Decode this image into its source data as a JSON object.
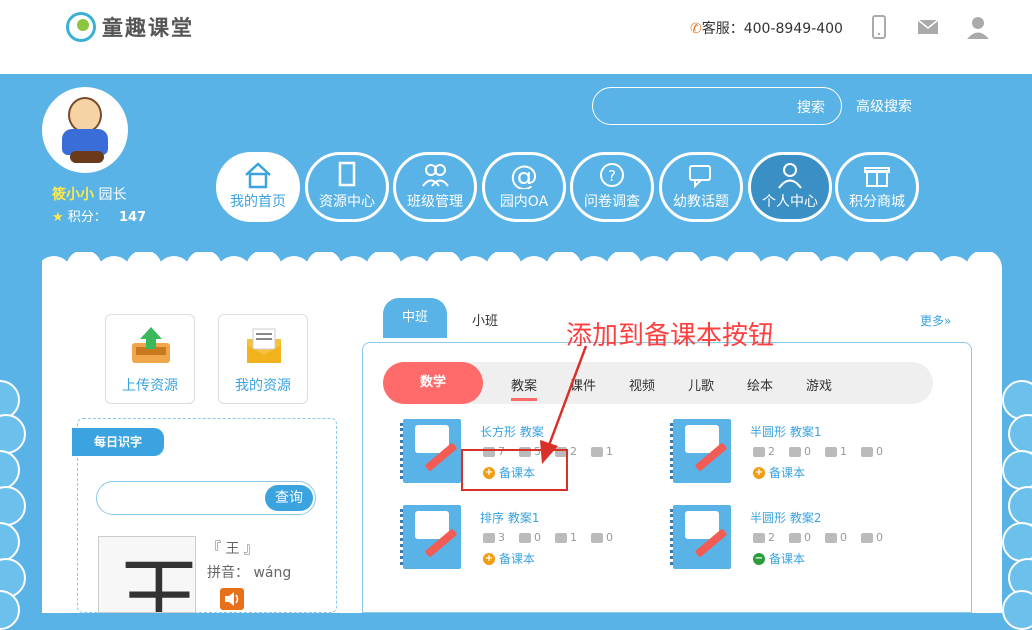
{
  "header": {
    "logo_text": "童趣课堂",
    "service_label": "客服：",
    "service_phone": "400-8949-400"
  },
  "user": {
    "name": "筱小小",
    "role": "园长",
    "points_label": "积分：",
    "points": "147"
  },
  "search": {
    "button": "搜索",
    "advanced": "高级搜索"
  },
  "nav": [
    {
      "label": "我的首页"
    },
    {
      "label": "资源中心"
    },
    {
      "label": "班级管理"
    },
    {
      "label": "园内OA"
    },
    {
      "label": "问卷调查"
    },
    {
      "label": "幼教话题"
    },
    {
      "label": "个人中心"
    },
    {
      "label": "积分商城"
    }
  ],
  "quick": {
    "upload": "上传资源",
    "mine": "我的资源"
  },
  "daily_word": {
    "tag": "每日识字",
    "query_btn": "查询",
    "char": "王",
    "char_name": "『 王 』",
    "pinyin_label": "拼音：",
    "pinyin": "wáng"
  },
  "class_tabs": {
    "active": "中班",
    "other": "小班",
    "more": "更多»"
  },
  "subject_tabs": {
    "active": "数学",
    "items": [
      "教案",
      "课件",
      "视频",
      "儿歌",
      "绘本",
      "游戏"
    ]
  },
  "annotation": "添加到备课本按钮",
  "resources": [
    {
      "title": "长方形 教案",
      "views": "7",
      "comments": "5",
      "likes": "2",
      "shares": "1",
      "add_label": "备课本"
    },
    {
      "title": "半圆形 教案1",
      "views": "2",
      "comments": "0",
      "likes": "1",
      "shares": "0",
      "add_label": "备课本"
    },
    {
      "title": "排序 教案1",
      "views": "3",
      "comments": "0",
      "likes": "1",
      "shares": "0",
      "add_label": "备课本"
    },
    {
      "title": "半圆形 教案2",
      "views": "2",
      "comments": "0",
      "likes": "0",
      "shares": "0",
      "add_label": "备课本"
    }
  ],
  "colors": {
    "primary": "#5ab3e6",
    "accent_red": "#ff6a6a",
    "annotation_red": "#ff4040",
    "add_orange": "#f39c12",
    "added_green": "#2a9d3a"
  }
}
